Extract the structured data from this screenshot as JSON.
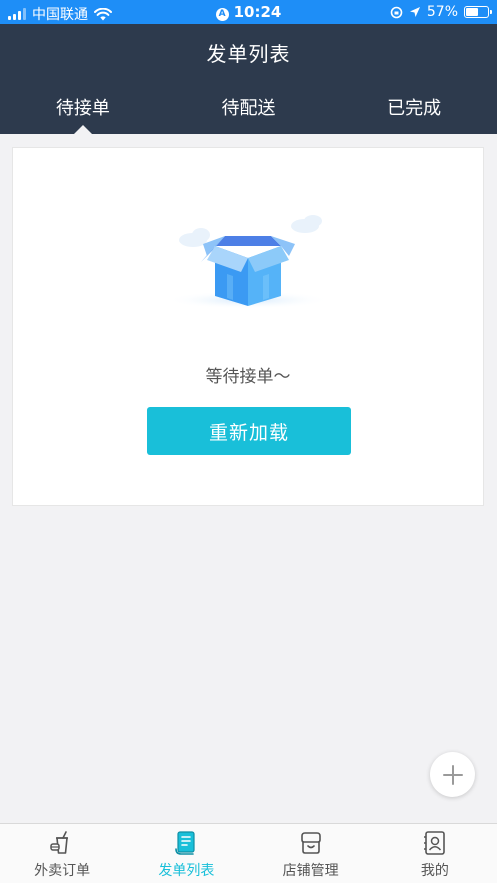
{
  "status_bar": {
    "carrier": "中国联通",
    "time": "10:24",
    "battery": "57%",
    "battery_level": 0.57
  },
  "header": {
    "title": "发单列表",
    "tabs": [
      {
        "label": "待接单",
        "active": true
      },
      {
        "label": "待配送",
        "active": false
      },
      {
        "label": "已完成",
        "active": false
      }
    ]
  },
  "empty_state": {
    "icon": "box-icon",
    "message": "等待接单～",
    "reload_label": "重新加载"
  },
  "fab": {
    "icon": "plus-icon"
  },
  "bottom_nav": [
    {
      "label": "外卖订单",
      "icon": "takeout-cup-icon",
      "active": false
    },
    {
      "label": "发单列表",
      "icon": "order-list-icon",
      "active": true
    },
    {
      "label": "店铺管理",
      "icon": "store-icon",
      "active": false
    },
    {
      "label": "我的",
      "icon": "profile-card-icon",
      "active": false
    }
  ],
  "colors": {
    "status_bar": "#1e8ef7",
    "header": "#2d3a4d",
    "accent": "#19bfd9",
    "background": "#f2f2f4"
  }
}
